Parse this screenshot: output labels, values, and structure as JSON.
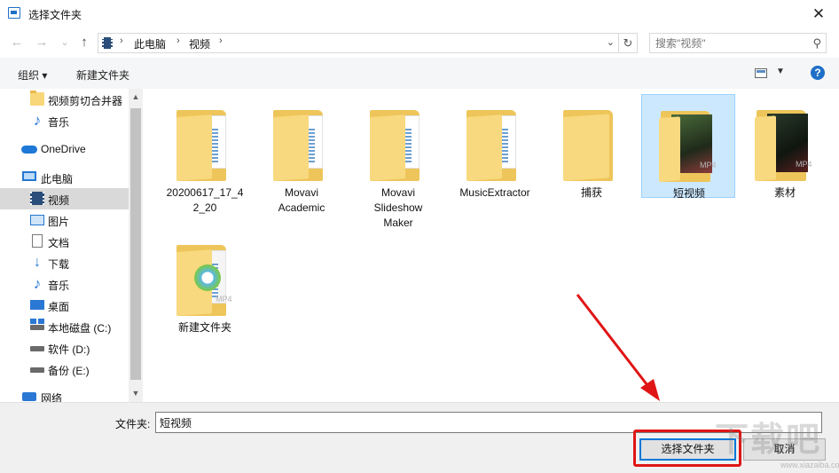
{
  "window": {
    "title": "选择文件夹",
    "close_glyph": "✕"
  },
  "nav": {
    "back_glyph": "←",
    "forward_glyph": "→",
    "recent_glyph": "⌄",
    "up_glyph": "↑",
    "breadcrumb": [
      "此电脑",
      "视频"
    ],
    "breadcrumb_sep": "›",
    "refresh_glyph": "↻",
    "search_placeholder": "搜索\"视频\""
  },
  "toolbar": {
    "organize": "组织 ▾",
    "new_folder": "新建文件夹",
    "help": "?"
  },
  "sidebar": {
    "items": [
      {
        "label": "视频剪切合并器",
        "icon": "folder-icon"
      },
      {
        "label": "音乐",
        "icon": "music-icon"
      },
      {
        "label": "OneDrive",
        "icon": "onedrive-icon"
      },
      {
        "label": "此电脑",
        "icon": "this-pc-icon"
      },
      {
        "label": "视频",
        "icon": "videos-icon",
        "selected": true
      },
      {
        "label": "图片",
        "icon": "pictures-icon"
      },
      {
        "label": "文档",
        "icon": "documents-icon"
      },
      {
        "label": "下载",
        "icon": "downloads-icon"
      },
      {
        "label": "音乐",
        "icon": "music-icon"
      },
      {
        "label": "桌面",
        "icon": "desktop-icon"
      },
      {
        "label": "本地磁盘 (C:)",
        "icon": "local-disk-icon"
      },
      {
        "label": "软件 (D:)",
        "icon": "drive-icon"
      },
      {
        "label": "备份 (E:)",
        "icon": "drive-icon"
      },
      {
        "label": "网络",
        "icon": "network-icon"
      }
    ]
  },
  "folders": [
    {
      "name": "20200617_17_42_20",
      "display": [
        "20200617_17_4",
        "2_20"
      ],
      "type": "video-folder"
    },
    {
      "name": "Movavi Academic",
      "display": [
        "Movavi",
        "Academic"
      ],
      "type": "video-folder"
    },
    {
      "name": "Movavi Slideshow Maker",
      "display": [
        "Movavi",
        "Slideshow",
        "Maker"
      ],
      "type": "video-folder"
    },
    {
      "name": "MusicExtractor",
      "display": [
        "MusicExtractor"
      ],
      "type": "video-folder"
    },
    {
      "name": "捕获",
      "display": [
        "捕获"
      ],
      "type": "empty-folder"
    },
    {
      "name": "短视频",
      "display": [
        "短视频"
      ],
      "type": "photo-folder",
      "selected": true
    },
    {
      "name": "素材",
      "display": [
        "素材"
      ],
      "type": "photo-folder"
    },
    {
      "name": "新建文件夹",
      "display": [
        "新建文件夹"
      ],
      "type": "media-folder"
    }
  ],
  "folder_tag": "MP4",
  "bottom": {
    "folder_label": "文件夹:",
    "folder_value": "短视频",
    "select_button": "选择文件夹",
    "cancel_button": "取消"
  },
  "watermark": {
    "text": "下载吧",
    "url": "www.xiazaiba.com"
  },
  "colors": {
    "accent": "#0078d7",
    "annotation": "#e01515",
    "selection": "#cce8ff"
  }
}
